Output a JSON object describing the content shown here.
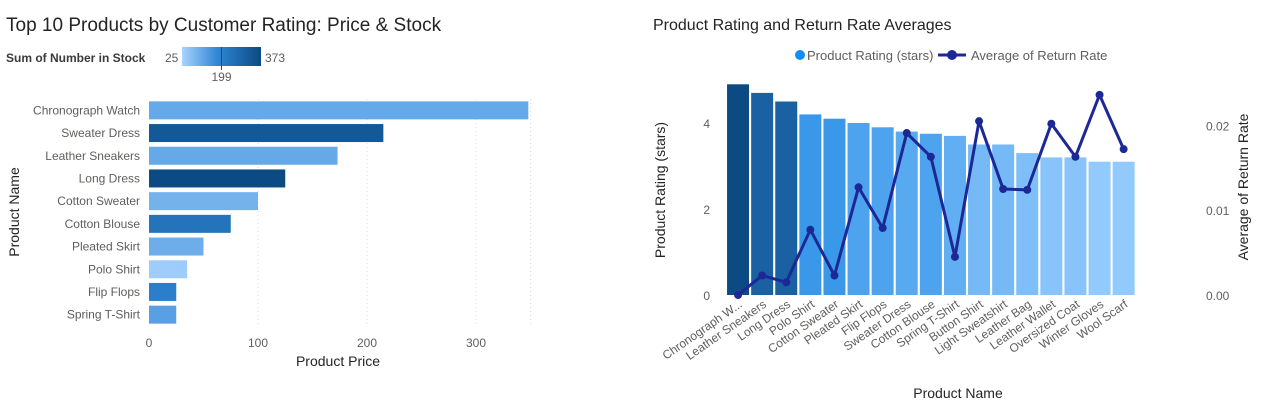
{
  "left_title": "Top 10 Products by Customer Rating: Price & Stock",
  "right_title": "Product Rating and Return Rate Averages",
  "colors": {
    "light": "#a9d3ff",
    "dark": "#0b4a83",
    "mid": "#2f86d4",
    "line": "#1c2896",
    "grid": "#d9d9d9",
    "axis_text": "#605e5c"
  },
  "chart_data": [
    {
      "type": "bar",
      "orientation": "horizontal",
      "title": "Top 10 Products by Customer Rating: Price & Stock",
      "xlabel": "Product Price",
      "ylabel": "Product Name",
      "xlim": [
        0,
        350
      ],
      "xticks": [
        0,
        100,
        200,
        300
      ],
      "categories": [
        "Chronograph Watch",
        "Sweater Dress",
        "Leather Sneakers",
        "Long Dress",
        "Cotton Sweater",
        "Cotton Blouse",
        "Pleated Skirt",
        "Polo Shirt",
        "Flip Flops",
        "Spring T-Shirt"
      ],
      "values": [
        348,
        215,
        173,
        125,
        100,
        75,
        50,
        35,
        25,
        25
      ],
      "color_legend": {
        "title": "Sum of Number in Stock",
        "min": 25,
        "mid": 199,
        "max": 373
      },
      "color_values": [
        120,
        330,
        120,
        373,
        100,
        250,
        110,
        40,
        220,
        140
      ],
      "grid": "vertical dotted"
    },
    {
      "type": "bar+line",
      "title": "Product Rating and Return Rate Averages",
      "xlabel": "Product Name",
      "ylabel_left": "Product Rating (stars)",
      "ylabel_right": "Average of Return Rate",
      "legend": [
        "Product Rating (stars)",
        "Average of Return Rate"
      ],
      "legend_position": "top-center",
      "categories": [
        "Chronograph W...",
        "Leather Sneakers",
        "Long Dress",
        "Polo Shirt",
        "Cotton Sweater",
        "Pleated Skirt",
        "Flip Flops",
        "Sweater Dress",
        "Cotton Blouse",
        "Spring T-Shirt",
        "Button Shirt",
        "Light Sweatshirt",
        "Leather Bag",
        "Leather Wallet",
        "Oversized Coat",
        "Winter Gloves",
        "Wool Scarf"
      ],
      "rating": [
        4.9,
        4.7,
        4.5,
        4.2,
        4.1,
        4.0,
        3.9,
        3.8,
        3.75,
        3.7,
        3.5,
        3.5,
        3.3,
        3.2,
        3.2,
        3.1,
        3.1
      ],
      "return_rate": [
        0.0,
        0.0023,
        0.0015,
        0.0077,
        0.0023,
        0.0127,
        0.0079,
        0.0191,
        0.0163,
        0.0045,
        0.0205,
        0.0125,
        0.0124,
        0.0202,
        0.0163,
        0.0236,
        0.0172
      ],
      "bar_color_levels": [
        1.0,
        0.85,
        0.85,
        0.5,
        0.5,
        0.4,
        0.4,
        0.35,
        0.4,
        0.3,
        0.2,
        0.2,
        0.15,
        0.1,
        0.1,
        0.05,
        0.05
      ],
      "ylim_left": [
        0,
        5
      ],
      "yticks_left": [
        0,
        2,
        4
      ],
      "ylim_right": [
        0,
        0.025
      ],
      "yticks_right": [
        "0.00",
        "0.01",
        "0.02"
      ]
    }
  ]
}
